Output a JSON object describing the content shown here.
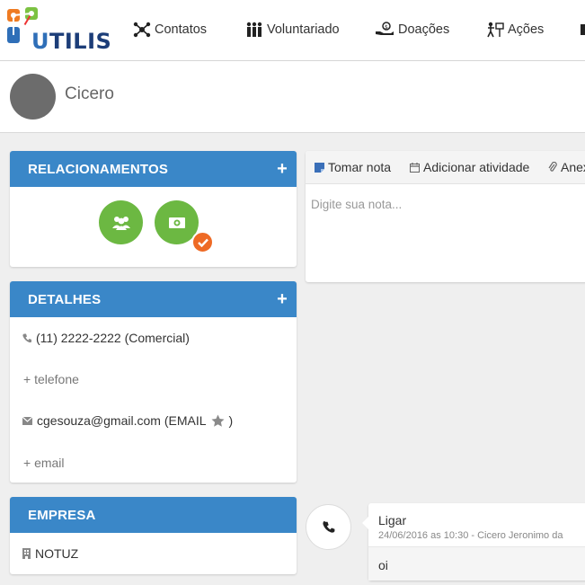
{
  "app": {
    "logo_text": "UTILIS",
    "logo_letter": "U",
    "logo_rest": "TILIS"
  },
  "nav": {
    "items": [
      {
        "label": "Contatos",
        "icon": "network-icon"
      },
      {
        "label": "Voluntariado",
        "icon": "people-icon"
      },
      {
        "label": "Doações",
        "icon": "donation-hand-icon"
      },
      {
        "label": "Ações",
        "icon": "action-icon"
      }
    ]
  },
  "profile": {
    "name": "Cicero"
  },
  "relationships": {
    "title": "RELACIONAMENTOS",
    "add_label": "+",
    "icons": [
      "group-icon",
      "money-icon"
    ],
    "colors": {
      "circle": "#6cb842",
      "badge": "#ee6a25"
    }
  },
  "details": {
    "title": "DETALHES",
    "add_label": "+",
    "phone": "(11) 2222-2222 (Comercial)",
    "add_phone": "+ telefone",
    "email": "cgesouza@gmail.com (EMAIL",
    "email_suffix": ")",
    "add_email": "+ email"
  },
  "company": {
    "title": "EMPRESA",
    "name": "NOTUZ"
  },
  "notes": {
    "tabs": [
      {
        "label": "Tomar nota",
        "icon": "note-icon"
      },
      {
        "label": "Adicionar atividade",
        "icon": "calendar-icon"
      },
      {
        "label": "Anexo",
        "icon": "paperclip-icon"
      }
    ],
    "placeholder": "Digite sua nota..."
  },
  "activity": {
    "title": "Ligar",
    "meta": "24/06/2016 as 10:30 - Cicero Jeronimo da",
    "body": "oi"
  },
  "colors": {
    "header_blue": "#3a87c8",
    "background": "#efefef"
  }
}
